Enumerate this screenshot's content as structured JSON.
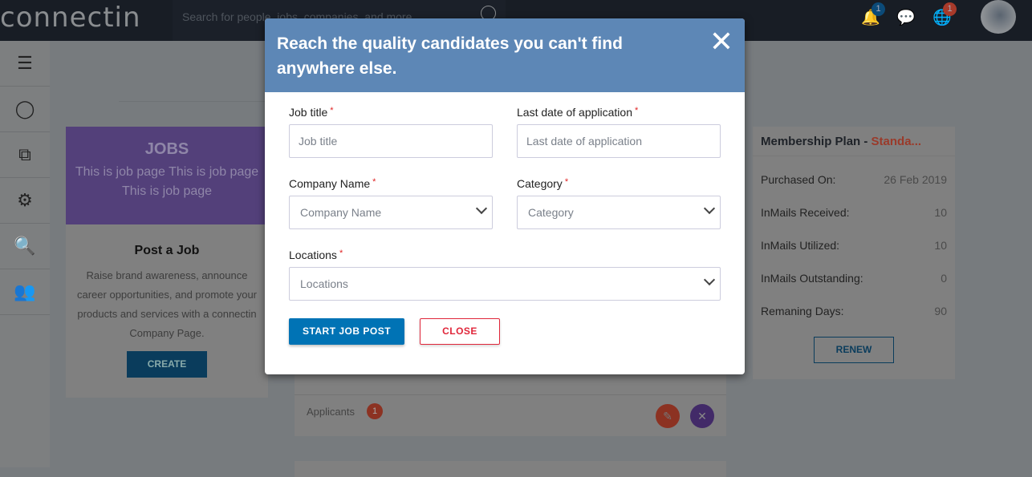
{
  "header": {
    "logo": "connectin",
    "search_placeholder": "Search for people, jobs, companies, and more...",
    "notifications_count": "1",
    "globe_count": "1"
  },
  "sidebar": {
    "items": [
      "menu",
      "profile",
      "network",
      "analytics",
      "job-search",
      "groups"
    ]
  },
  "jobs": {
    "title": "JOBS",
    "subtitle": "This is job page This is job page This is job page",
    "post_title": "Post a Job",
    "post_text": "Raise brand awareness, announce career opportunities, and promote your products and services with a connectin Company Page.",
    "create_label": "CREATE"
  },
  "job_item": {
    "applicants_label": "Applicants",
    "applicants_count": "1"
  },
  "membership": {
    "title": "Membership Plan - ",
    "plan": "Standa...",
    "rows": [
      {
        "label": "Purchased On:",
        "value": "26 Feb 2019"
      },
      {
        "label": "InMails Received:",
        "value": "10"
      },
      {
        "label": "InMails Utilized:",
        "value": "10"
      },
      {
        "label": "InMails Outstanding:",
        "value": "0"
      },
      {
        "label": "Remaning Days:",
        "value": "90"
      }
    ],
    "renew_label": "RENEW"
  },
  "modal": {
    "title": "Reach the quality candidates you can't find anywhere else.",
    "required": "*",
    "job_title_label": "Job title",
    "job_title_placeholder": "Job title",
    "last_date_label": "Last date of application",
    "last_date_placeholder": "Last date of application",
    "company_label": "Company Name",
    "company_placeholder": "Company Name",
    "category_label": "Category",
    "category_placeholder": "Category",
    "locations_label": "Locations",
    "locations_placeholder": "Locations",
    "start_label": "START JOB POST",
    "close_label": "CLOSE"
  }
}
